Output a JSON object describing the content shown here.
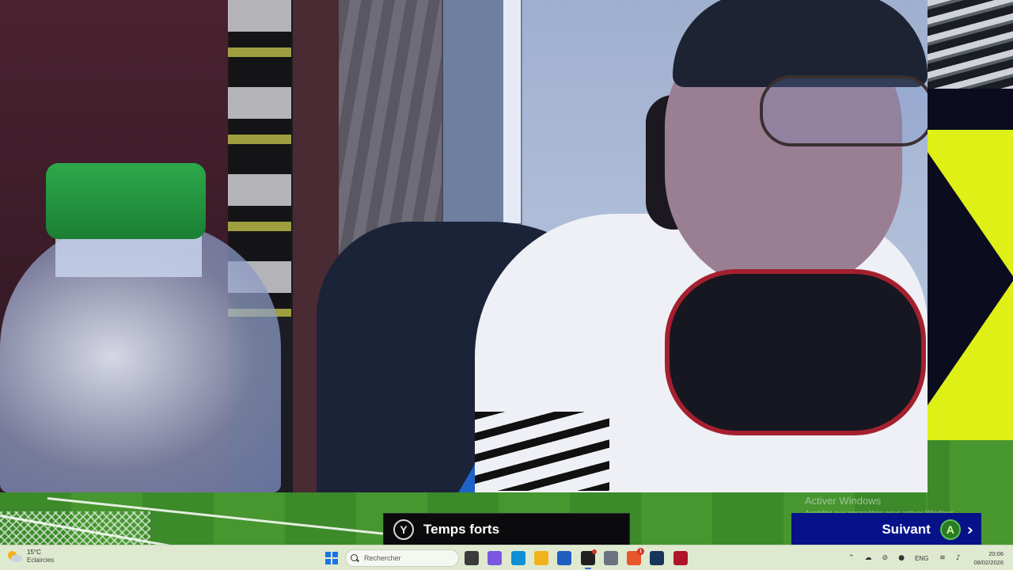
{
  "hud": {
    "highlights": {
      "button_glyph": "Y",
      "label": "Temps forts"
    },
    "next": {
      "label": "Suivant",
      "button_glyph": "A"
    }
  },
  "watermark": {
    "line1": "Activer Windows",
    "line2": "Accédez aux paramètres pour activer Windows."
  },
  "taskbar": {
    "weather": {
      "temp": "15°C",
      "condition": "Eclaircies"
    },
    "search_placeholder": "Rechercher",
    "pinned_apps": [
      {
        "name": "task-view",
        "color": "#3b3b3b"
      },
      {
        "name": "copilot",
        "color": "#7b57e0"
      },
      {
        "name": "edge",
        "color": "#0f8fd6"
      },
      {
        "name": "file-explorer",
        "color": "#f2b21b"
      },
      {
        "name": "microsoft-store",
        "color": "#1f5fbf"
      },
      {
        "name": "obs-studio",
        "color": "#202020",
        "dot_badge": true,
        "active": true
      },
      {
        "name": "settings",
        "color": "#6b7280"
      },
      {
        "name": "brave",
        "color": "#e8572a",
        "badge": "1"
      },
      {
        "name": "steam",
        "color": "#17345a"
      },
      {
        "name": "ea-app",
        "color": "#b0152b"
      }
    ],
    "tray": {
      "lang": "ENG"
    },
    "clock": {
      "time": "20:06",
      "date": "08/02/2026"
    }
  },
  "colors": {
    "next_button_bg": "#07128a",
    "a_button": "#2a7a26",
    "taskbar_bg": "#dfe9cf",
    "accent_yellow": "#dff016"
  }
}
